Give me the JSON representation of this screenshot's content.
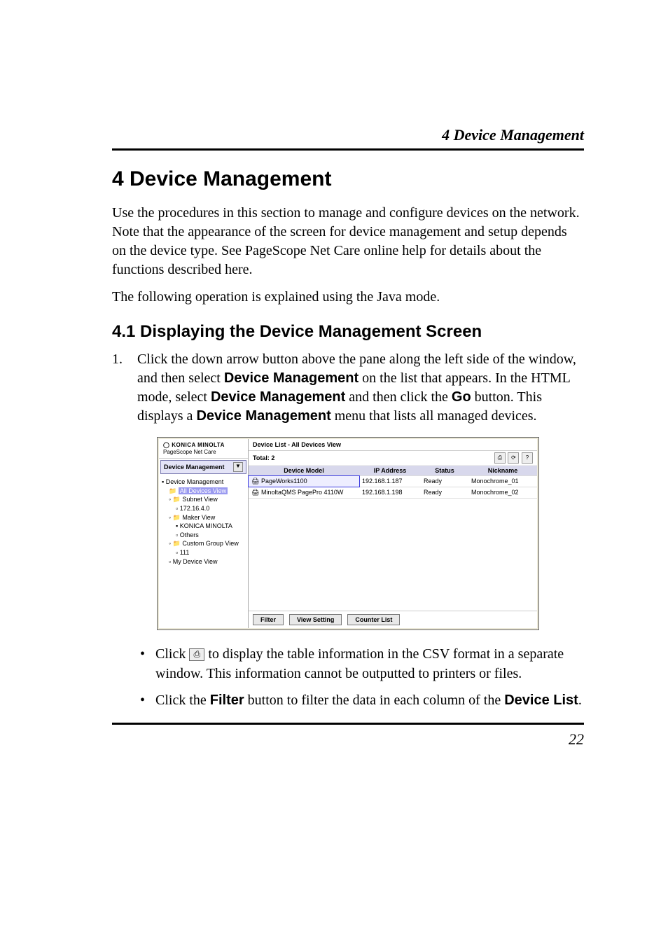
{
  "running_head": "4  Device Management",
  "h1": "4   Device Management",
  "p1": "Use the procedures in this section to manage and configure devices on the network. Note that the appearance of the screen for device management and setup depends on the device type. See PageScope Net Care online help for details about the functions described here.",
  "p2": "The following operation is explained using the Java mode.",
  "h2": "4.1   Displaying the Device Management Screen",
  "step1_num": "1.",
  "step1_a": "Click the down arrow button above the pane along the left side of the window, and then select ",
  "step1_b": "Device Management",
  "step1_c": " on the list that appears. In the HTML mode, select ",
  "step1_d": "Device Management",
  "step1_e": " and then click the ",
  "step1_f": "Go",
  "step1_g": " button. This displays a ",
  "step1_h": "Device Management",
  "step1_i": " menu that lists all managed devices.",
  "screenshot": {
    "brand_logo": "KONICA MINOLTA",
    "brand_app": "PageScope Net Care",
    "dropdown_label": "Device Management",
    "tree": {
      "root": "Device Management",
      "all_devices": "All Devices View",
      "subnet": "Subnet View",
      "subnet_ip": "172.16.4.0",
      "maker": "Maker View",
      "maker_km": "KONICA MINOLTA",
      "maker_others": "Others",
      "custom": "Custom Group View",
      "custom_111": "111",
      "mydevice": "My Device View"
    },
    "list_title": "Device List - All Devices View",
    "total_label": "Total: 2",
    "columns": {
      "model": "Device Model",
      "ip": "IP Address",
      "status": "Status",
      "nick": "Nickname"
    },
    "rows": [
      {
        "model": "PageWorks1100",
        "ip": "192.168.1.187",
        "status": "Ready",
        "nick": "Monochrome_01"
      },
      {
        "model": "MinoltaQMS PagePro 4110W",
        "ip": "192.168.1.198",
        "status": "Ready",
        "nick": "Monochrome_02"
      }
    ],
    "buttons": {
      "filter": "Filter",
      "view_setting": "View Setting",
      "counter_list": "Counter List"
    }
  },
  "note1_a": "Click  ",
  "note1_b": "  to display the table information in the CSV format in a separate window. This information cannot be outputted to printers or files.",
  "note2_a": "Click the ",
  "note2_b": "Filter",
  "note2_c": " button to filter the data in each column of the ",
  "note2_d": "Device List",
  "note2_e": ".",
  "page_number": "22"
}
